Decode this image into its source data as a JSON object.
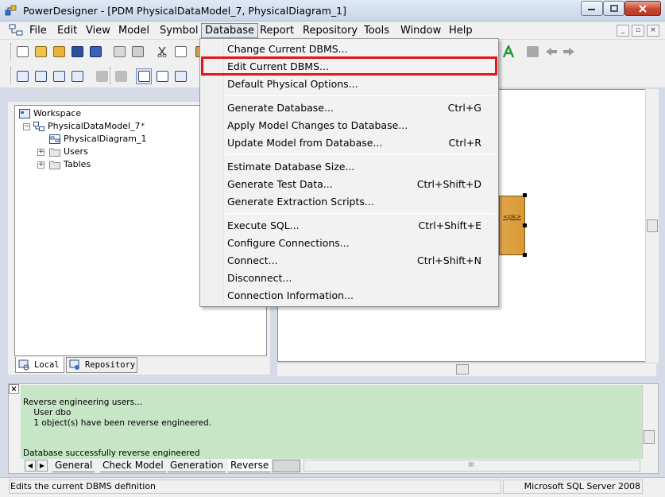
{
  "window": {
    "title": "PowerDesigner - [PDM PhysicalDataModel_7, PhysicalDiagram_1]",
    "min": "0",
    "max": "1",
    "close": "r"
  },
  "menu": {
    "items": [
      "File",
      "Edit",
      "View",
      "Model",
      "Symbol",
      "Database",
      "Report",
      "Repository",
      "Tools",
      "Window",
      "Help"
    ],
    "active": "Database"
  },
  "mdi_buttons": [
    "_",
    "▫",
    "×"
  ],
  "workspace": {
    "root": "Workspace",
    "model": "PhysicalDataModel_7",
    "model_marker": "*",
    "diagram": "PhysicalDiagram_1",
    "folders": [
      "Users",
      "Tables"
    ],
    "tabs": [
      "Local",
      "Repository"
    ]
  },
  "diagram": {
    "entity_pk": "<pk>"
  },
  "database_menu": {
    "groups": [
      [
        {
          "label": "Change Current DBMS...",
          "shortcut": ""
        },
        {
          "label": "Edit Current DBMS...",
          "shortcut": ""
        },
        {
          "label": "Default Physical Options...",
          "shortcut": ""
        }
      ],
      [
        {
          "label": "Generate Database...",
          "shortcut": "Ctrl+G"
        },
        {
          "label": "Apply Model Changes to Database...",
          "shortcut": ""
        },
        {
          "label": "Update Model from Database...",
          "shortcut": "Ctrl+R"
        }
      ],
      [
        {
          "label": "Estimate Database Size...",
          "shortcut": ""
        },
        {
          "label": "Generate Test Data...",
          "shortcut": "Ctrl+Shift+D"
        },
        {
          "label": "Generate Extraction Scripts...",
          "shortcut": ""
        }
      ],
      [
        {
          "label": "Execute SQL...",
          "shortcut": "Ctrl+Shift+E"
        },
        {
          "label": "Configure Connections...",
          "shortcut": ""
        },
        {
          "label": "Connect...",
          "shortcut": "Ctrl+Shift+N"
        },
        {
          "label": "Disconnect...",
          "shortcut": ""
        },
        {
          "label": "Connection Information...",
          "shortcut": ""
        }
      ]
    ],
    "highlighted": "Edit Current DBMS..."
  },
  "output": {
    "lines": [
      "Reverse engineering users...",
      "    User dbo",
      "    1 object(s) have been reverse engineered.",
      "Database successfully reverse engineered"
    ],
    "tabs": [
      "General",
      "Check Model",
      "Generation",
      "Reverse"
    ],
    "active_tab": "Reverse"
  },
  "status": {
    "left": "Edits the current DBMS definition",
    "right": "Microsoft SQL Server 2008"
  },
  "colors": {
    "highlight_border": "#e4141b",
    "output_bg": "#c6e6c6",
    "entity_fill": "#dc9f3d"
  }
}
